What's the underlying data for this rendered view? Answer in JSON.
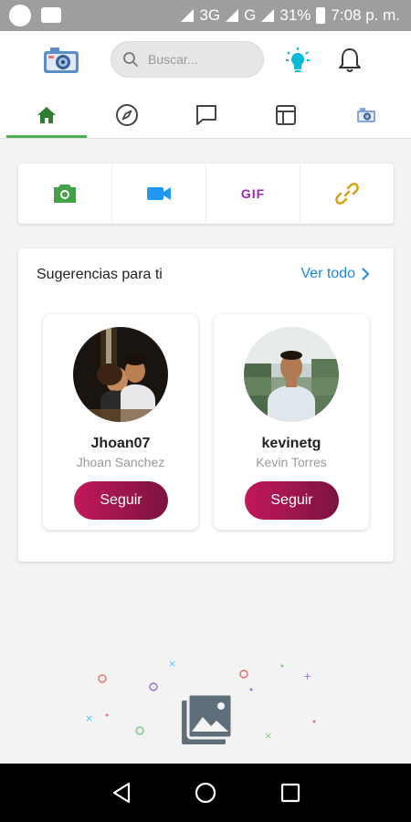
{
  "status_bar": {
    "network": "3G",
    "network2": "G",
    "battery": "31%",
    "time": "7:08 p. m."
  },
  "app_bar": {
    "search_placeholder": "Buscar..."
  },
  "tabs": [
    {
      "name": "home",
      "active": true
    },
    {
      "name": "explore",
      "active": false
    },
    {
      "name": "messages",
      "active": false
    },
    {
      "name": "dashboard",
      "active": false
    },
    {
      "name": "gallery",
      "active": false
    }
  ],
  "media_actions": {
    "gif_label": "GIF"
  },
  "suggestions": {
    "title": "Sugerencias para ti",
    "see_all": "Ver todo",
    "users": [
      {
        "username": "Jhoan07",
        "full_name": "Jhoan Sanchez",
        "follow_label": "Seguir"
      },
      {
        "username": "kevinetg",
        "full_name": "Kevin Torres",
        "follow_label": "Seguir"
      }
    ]
  },
  "colors": {
    "accent_green": "#4caf50",
    "link_blue": "#1e88e5",
    "follow_start": "#c2185b",
    "follow_end": "#7b1340",
    "gif_purple": "#9c27b0",
    "video_blue": "#2196f3",
    "link_gold": "#d4a017",
    "bulb_cyan": "#00bcd4"
  }
}
